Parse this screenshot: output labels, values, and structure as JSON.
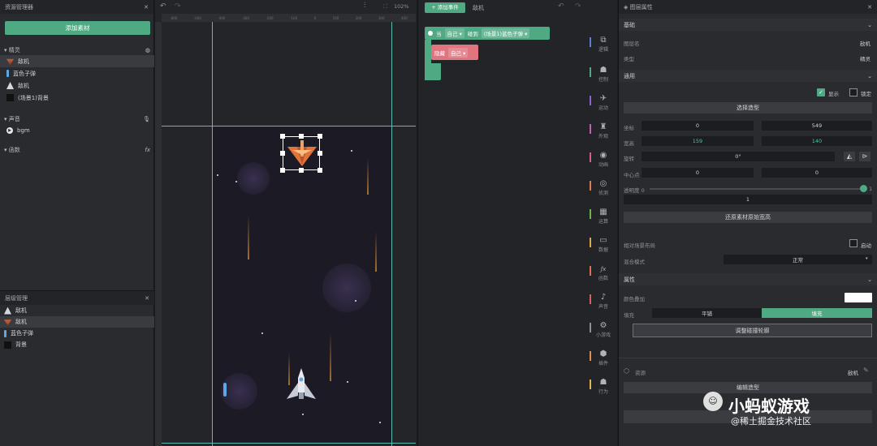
{
  "assets": {
    "title": "资源管理器",
    "add_button": "添加素材"
  },
  "sprites": {
    "heading": "精灵",
    "items": [
      "敌机",
      "蓝色子弹",
      "敌机",
      "(场景1)背景"
    ]
  },
  "sound": {
    "heading": "声音",
    "items": [
      "bgm"
    ]
  },
  "functions": {
    "heading": "函数"
  },
  "layers": {
    "title": "层级管理",
    "items": [
      "敌机",
      "敌机",
      "蓝色子弹",
      "背景"
    ]
  },
  "canvas": {
    "zoom": "102%",
    "ruler": [
      "-800",
      "-600",
      "-400",
      "-300",
      "-200",
      "-100",
      "0",
      "100",
      "200",
      "300",
      "400"
    ]
  },
  "events": {
    "add_button": "+ 添加事件",
    "tab": "敌机",
    "when": "当",
    "self": "自己 ▾",
    "touch": "碰到",
    "target": "(场景1)蓝色子弹 ▾",
    "hide": "隐藏",
    "hide_self": "自己 ▾"
  },
  "categories": [
    {
      "label": "逻辑",
      "icon": "⧉",
      "color": "#5b7fd6"
    },
    {
      "label": "控制",
      "icon": "☗",
      "color": "#4fa983"
    },
    {
      "label": "运动",
      "icon": "✈",
      "color": "#8e5fd6"
    },
    {
      "label": "外观",
      "icon": "♜",
      "color": "#c25ec0"
    },
    {
      "label": "动画",
      "icon": "◉",
      "color": "#d65f8a"
    },
    {
      "label": "侦测",
      "icon": "◎",
      "color": "#e07a4f"
    },
    {
      "label": "运算",
      "icon": "▦",
      "color": "#6bb54f"
    },
    {
      "label": "数据",
      "icon": "▭",
      "color": "#e0a84f"
    },
    {
      "label": "函数",
      "icon": "ƒx",
      "color": "#e06f4f"
    },
    {
      "label": "声音",
      "icon": "♪",
      "color": "#d65f5f"
    },
    {
      "label": "小游戏",
      "icon": "⚙",
      "color": "#8f8f8f"
    },
    {
      "label": "插件",
      "icon": "⬢",
      "color": "#e08f4f"
    },
    {
      "label": "行为",
      "icon": "☗",
      "color": "#e0b64f"
    }
  ],
  "props": {
    "title": "图层属性",
    "basic": "基础",
    "layer_name_label": "图层名",
    "layer_name": "敌机",
    "type_label": "类型",
    "type": "精灵",
    "general": "通用",
    "show": "显示",
    "lock": "锁定",
    "choose_shape": "选择造型",
    "coord_label": "坐标",
    "x": "0",
    "y": "549",
    "size_label": "宽高",
    "w": "159",
    "h": "140",
    "rotate_label": "旋转",
    "rotate": "0°",
    "pivot_label": "中心点",
    "px": "0",
    "py": "0",
    "opacity_label": "透明度 0",
    "opacity_max": "1",
    "opacity": "1",
    "restore": "还原素材原始宽高",
    "relative_label": "相对场景布局",
    "enable": "启动",
    "blend_label": "混合模式",
    "blend": "正常",
    "attrs": "属性",
    "color_label": "颜色叠加",
    "fill_label": "填充",
    "tile": "平铺",
    "fill": "填充",
    "collision": "调整碰撞轮廓",
    "resource_label": "资源",
    "resource": "敌机",
    "edit_shape": "编辑造型"
  },
  "watermark": {
    "brand": "小蚂蚁游戏",
    "sub": "@稀土掘金技术社区"
  }
}
